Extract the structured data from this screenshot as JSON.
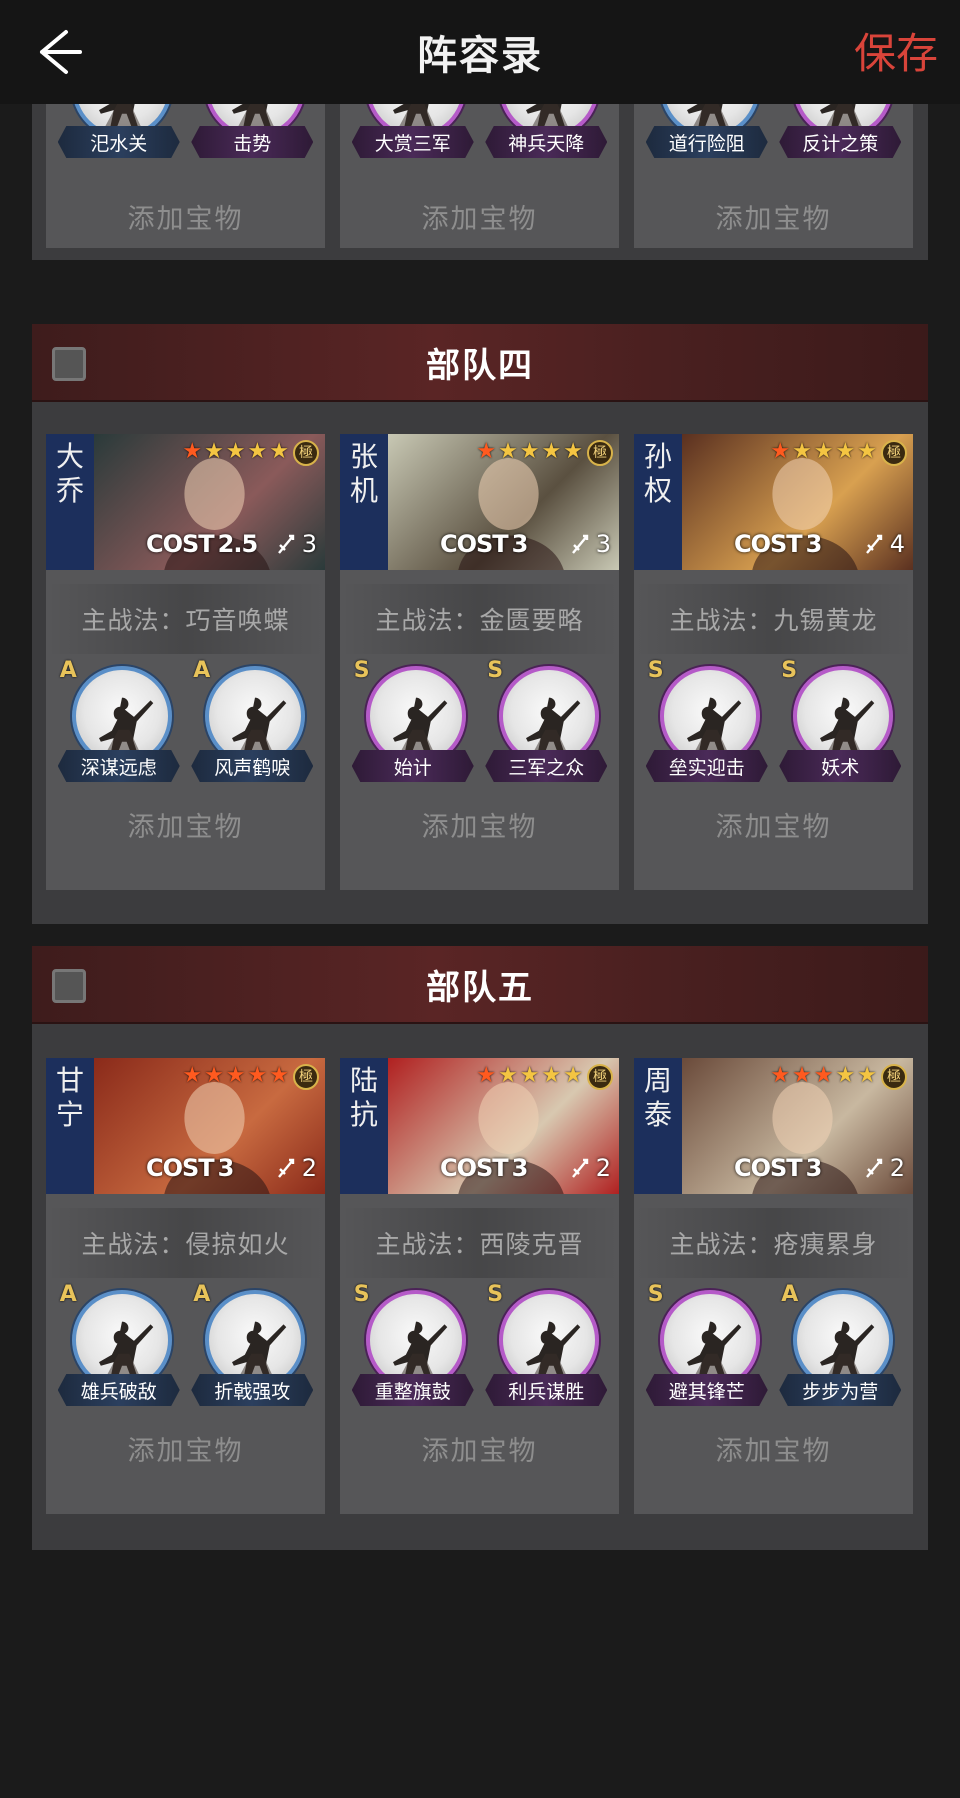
{
  "header": {
    "title": "阵容录",
    "save_label": "保存"
  },
  "colors": {
    "accent": "#d9443a",
    "squad_header": "#5a2525",
    "nameplate": "#1c2f5c"
  },
  "partial_squad": {
    "skills": [
      [
        {
          "name": "汜水关",
          "color": "blue"
        },
        {
          "name": "击势",
          "color": "purple"
        }
      ],
      [
        {
          "name": "大赏三军",
          "color": "purple"
        },
        {
          "name": "神兵天降",
          "color": "purple"
        }
      ],
      [
        {
          "name": "道行险阻",
          "color": "blue"
        },
        {
          "name": "反计之策",
          "color": "purple"
        }
      ]
    ],
    "treasure_label": "添加宝物"
  },
  "squads": [
    {
      "title": "部队四",
      "heroes": [
        {
          "name": [
            "大",
            "乔"
          ],
          "stars_red": 1,
          "stars_total": 5,
          "rank": "極",
          "cost_label": "COST",
          "cost": "2.5",
          "unit": "3",
          "unit_icon": "archer-icon",
          "main_skill": "主战法：巧音唤蝶",
          "skills": [
            {
              "grade": "A",
              "name": "深谋远虑",
              "color": "blue"
            },
            {
              "grade": "A",
              "name": "风声鹤唳",
              "color": "blue"
            }
          ],
          "treasure_label": "添加宝物",
          "art_colors": [
            "#2a3a3a",
            "#8a5a5a"
          ]
        },
        {
          "name": [
            "张",
            "机"
          ],
          "stars_red": 1,
          "stars_total": 5,
          "rank": "極",
          "cost_label": "COST",
          "cost": "3",
          "unit": "3",
          "unit_icon": "archer-icon",
          "main_skill": "主战法：金匮要略",
          "skills": [
            {
              "grade": "S",
              "name": "始计",
              "color": "purple"
            },
            {
              "grade": "S",
              "name": "三军之众",
              "color": "purple"
            }
          ],
          "treasure_label": "添加宝物",
          "art_colors": [
            "#c8c8b4",
            "#5a5040"
          ]
        },
        {
          "name": [
            "孙",
            "权"
          ],
          "stars_red": 1,
          "stars_total": 5,
          "rank": "極",
          "cost_label": "COST",
          "cost": "3",
          "unit": "4",
          "unit_icon": "archer-icon",
          "main_skill": "主战法：九锡黄龙",
          "skills": [
            {
              "grade": "S",
              "name": "垒实迎击",
              "color": "purple"
            },
            {
              "grade": "S",
              "name": "妖术",
              "color": "purple"
            }
          ],
          "treasure_label": "添加宝物",
          "art_colors": [
            "#5a3020",
            "#d8a050"
          ]
        }
      ]
    },
    {
      "title": "部队五",
      "heroes": [
        {
          "name": [
            "甘",
            "宁"
          ],
          "stars_red": 5,
          "stars_total": 5,
          "rank": "極",
          "cost_label": "COST",
          "cost": "3",
          "unit": "2",
          "unit_icon": "cavalry-icon",
          "main_skill": "主战法：侵掠如火",
          "skills": [
            {
              "grade": "A",
              "name": "雄兵破敌",
              "color": "blue"
            },
            {
              "grade": "A",
              "name": "折戟强攻",
              "color": "blue"
            }
          ],
          "treasure_label": "添加宝物",
          "art_colors": [
            "#8a2a1a",
            "#c86a40"
          ]
        },
        {
          "name": [
            "陆",
            "抗"
          ],
          "stars_red": 1,
          "stars_total": 5,
          "rank": "極",
          "cost_label": "COST",
          "cost": "3",
          "unit": "2",
          "unit_icon": "cavalry-icon",
          "main_skill": "主战法：西陵克晋",
          "skills": [
            {
              "grade": "S",
              "name": "重整旗鼓",
              "color": "purple"
            },
            {
              "grade": "S",
              "name": "利兵谋胜",
              "color": "purple"
            }
          ],
          "treasure_label": "添加宝物",
          "art_colors": [
            "#b02020",
            "#d8c8b0"
          ]
        },
        {
          "name": [
            "周",
            "泰"
          ],
          "stars_red": 3,
          "stars_total": 5,
          "rank": "極",
          "cost_label": "COST",
          "cost": "3",
          "unit": "2",
          "unit_icon": "cavalry-icon",
          "main_skill": "主战法：疮痍累身",
          "skills": [
            {
              "grade": "S",
              "name": "避其锋芒",
              "color": "purple"
            },
            {
              "grade": "A",
              "name": "步步为营",
              "color": "blue"
            }
          ],
          "treasure_label": "添加宝物",
          "art_colors": [
            "#6a4a3a",
            "#c8b8a0"
          ]
        }
      ]
    }
  ]
}
